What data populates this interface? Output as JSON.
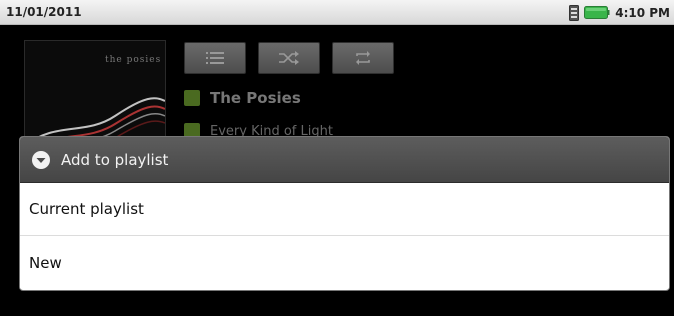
{
  "status_bar": {
    "date": "11/01/2011",
    "time": "4:10 PM",
    "icons": [
      "sim-card-icon",
      "battery-icon"
    ],
    "battery_color": "#39b54a"
  },
  "player": {
    "album_logo_text": "the posies",
    "controls": [
      "playlist-icon",
      "shuffle-icon",
      "repeat-icon"
    ],
    "artist": "The Posies",
    "album": "Every Kind of Light",
    "accent_color": "#8cbf2a"
  },
  "dialog": {
    "title": "Add to playlist",
    "title_icon": "chevron-down-circle-icon",
    "items": [
      {
        "label": "Current playlist"
      },
      {
        "label": "New"
      }
    ]
  }
}
